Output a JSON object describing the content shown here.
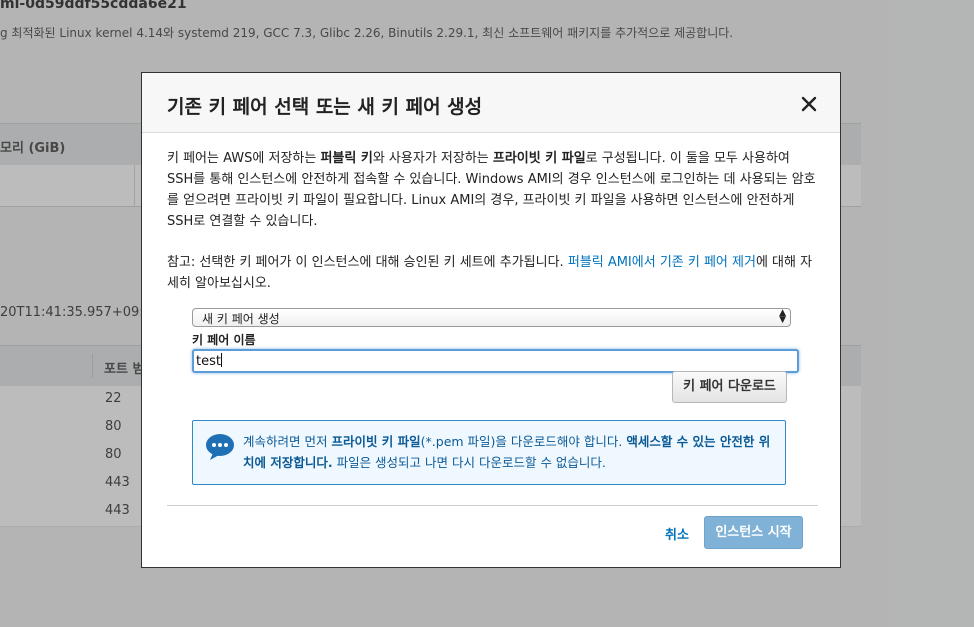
{
  "background": {
    "ami_id": "mi-0d59ddf55cdda6e21",
    "description": "g 최적화된 Linux kernel 4.14와 systemd 219, GCC 7.3, Glibc 2.26, Binutils 2.29.1, 최신 소프트웨어 패키지를 추가적으로 제공합니다.",
    "storage_header": "모리 (GiB)",
    "timestamp": "20T11:41:35.957+09:00",
    "port_header": "포트 범",
    "ports": [
      "22",
      "80",
      "80",
      "443",
      "443"
    ]
  },
  "modal": {
    "title": "기존 키 페어 선택 또는 새 키 페어 생성",
    "close_icon": "close-icon",
    "intro": {
      "t1": "키 페어는 AWS에 저장하는 ",
      "b1": "퍼블릭 키",
      "t2": "와 사용자가 저장하는 ",
      "b2": "프라이빗 키 파일",
      "t3": "로 구성됩니다. 이 둘을 모두 사용하여 SSH를 통해 인스턴스에 안전하게 접속할 수 있습니다. Windows AMI의 경우 인스턴스에 로그인하는 데 사용되는 암호를 얻으려면 프라이빗 키 파일이 필요합니다. Linux AMI의 경우, 프라이빗 키 파일을 사용하면 인스턴스에 안전하게 SSH로 연결할 수 있습니다."
    },
    "note": {
      "t1": "참고: 선택한 키 페어가 이 인스턴스에 대해 승인된 키 세트에 추가됩니다. ",
      "link": "퍼블릭 AMI에서 기존 키 페어 제거",
      "t2": "에 대해 자세히 알아보십시오."
    },
    "select_value": "새 키 페어 생성",
    "key_pair_label": "키 페어 이름",
    "key_pair_value": "test",
    "download_button": "키 페어 다운로드",
    "info": {
      "icon": "chat-bubble-icon",
      "t1": "계속하려면 먼저 ",
      "b1": "프라이빗 키 파일",
      "t2": "(*.pem 파일)을 다운로드해야 합니다. ",
      "b2": "액세스할 수 있는 안전한 위치에 저장합니다.",
      "t3": " 파일은 생성되고 나면 다시 다운로드할 수 없습니다."
    },
    "cancel": "취소",
    "launch": "인스턴스 시작"
  },
  "colors": {
    "link": "#0073bb",
    "info_border": "#2e8acb",
    "info_text": "#0b5a96",
    "launch_disabled": "#7fb2d6",
    "input_focus": "#5b9dd9"
  }
}
